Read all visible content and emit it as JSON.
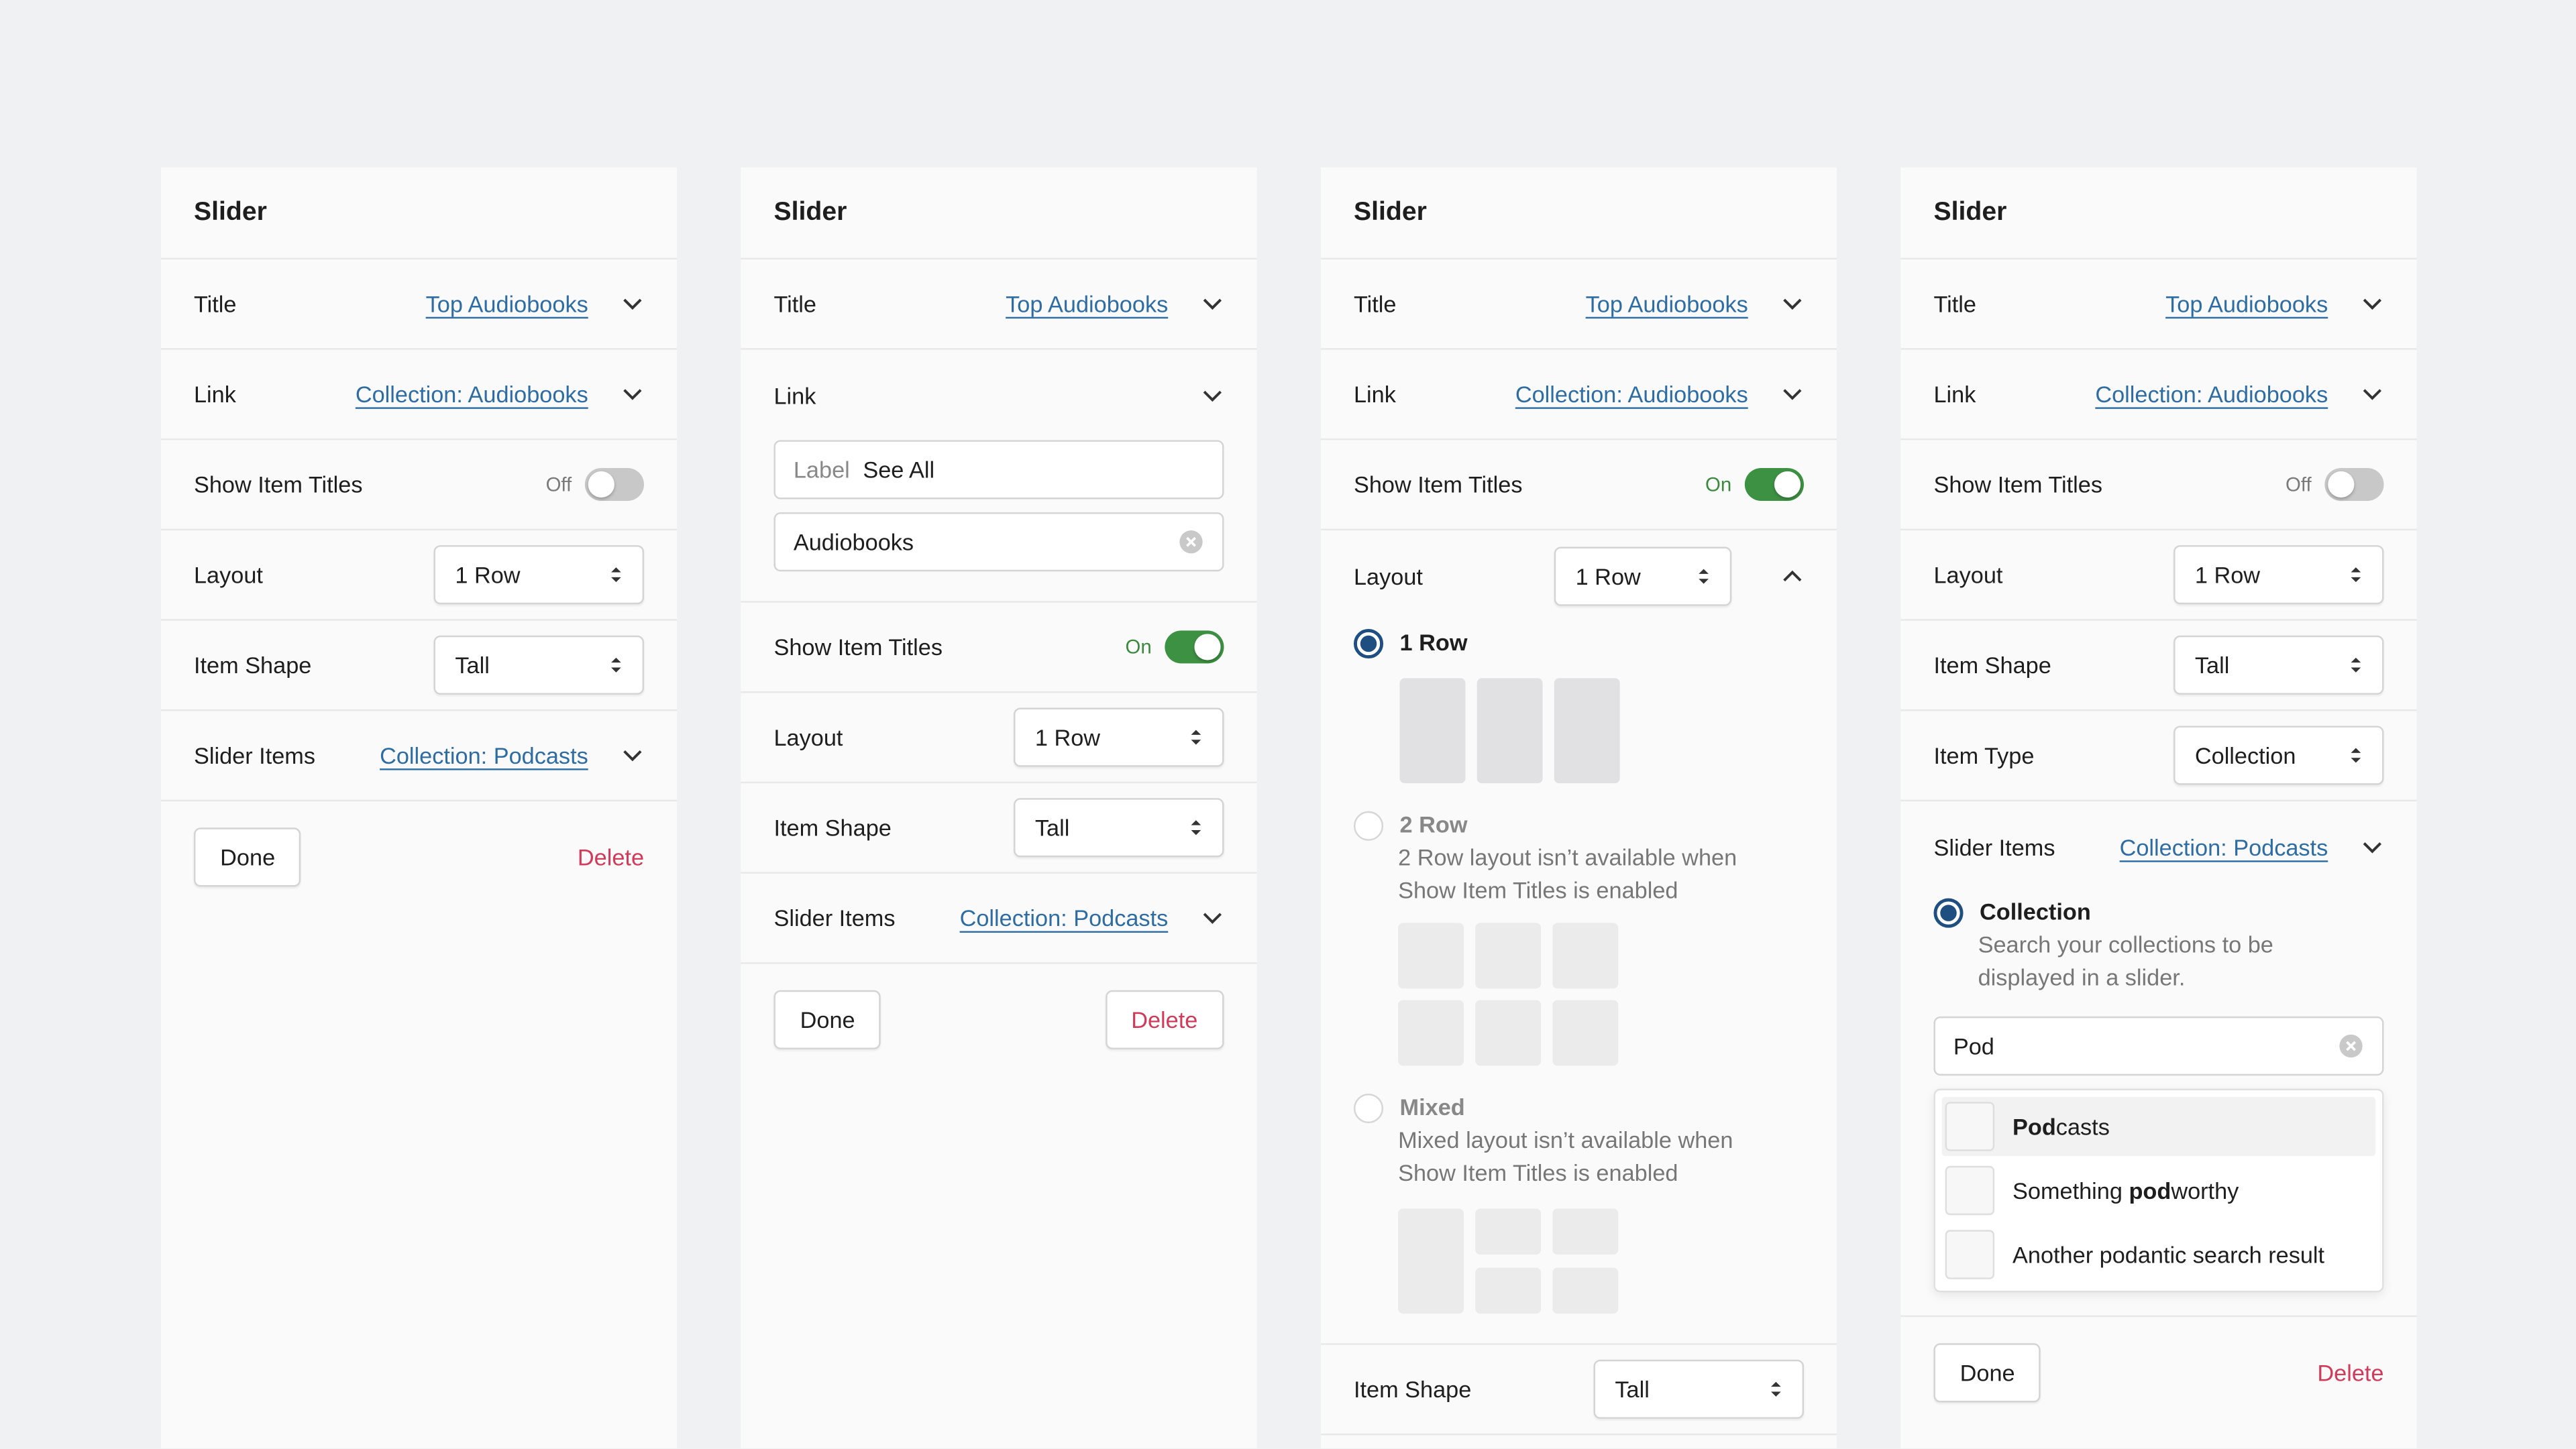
{
  "panel_title": "Slider",
  "labels": {
    "title": "Title",
    "link": "Link",
    "show_item_titles": "Show Item Titles",
    "layout": "Layout",
    "item_shape": "Item Shape",
    "item_type": "Item Type",
    "slider_items": "Slider Items"
  },
  "values": {
    "title": "Top Audiobooks",
    "link": "Collection: Audiobooks",
    "slider_items": "Collection: Podcasts",
    "layout": "1 Row",
    "item_shape": "Tall",
    "item_type": "Collection"
  },
  "toggle": {
    "off": "Off",
    "on": "On"
  },
  "buttons": {
    "done": "Done",
    "delete": "Delete"
  },
  "link_editor": {
    "label_placeholder": "Label",
    "label_value": "See All",
    "collection_value": "Audiobooks"
  },
  "layout_options": [
    {
      "title": "1 Row",
      "selected": true,
      "description": ""
    },
    {
      "title": "2 Row",
      "selected": false,
      "description": "2 Row layout isn’t available when Show Item Titles is enabled"
    },
    {
      "title": "Mixed",
      "selected": false,
      "description": "Mixed layout isn’t available when Show Item Titles is enabled"
    }
  ],
  "collection_option": {
    "title": "Collection",
    "description": "Search your collections to be displayed in a slider."
  },
  "search": {
    "query": "Pod",
    "results": [
      {
        "before": "",
        "match": "Pod",
        "after": "casts",
        "highlighted": true
      },
      {
        "before": "Something ",
        "match": "pod",
        "after": "worthy",
        "highlighted": false
      },
      {
        "before": "Another podantic search result",
        "match": "",
        "after": "",
        "highlighted": false
      }
    ]
  },
  "colors": {
    "link": "#2e6da4",
    "toggle_on": "#3d9142",
    "delete": "#d23a5a",
    "radio_selected": "#1e4f80"
  },
  "icons": [
    "chevron-down-icon",
    "chevron-up-icon",
    "select-arrows-icon",
    "clear-icon"
  ]
}
